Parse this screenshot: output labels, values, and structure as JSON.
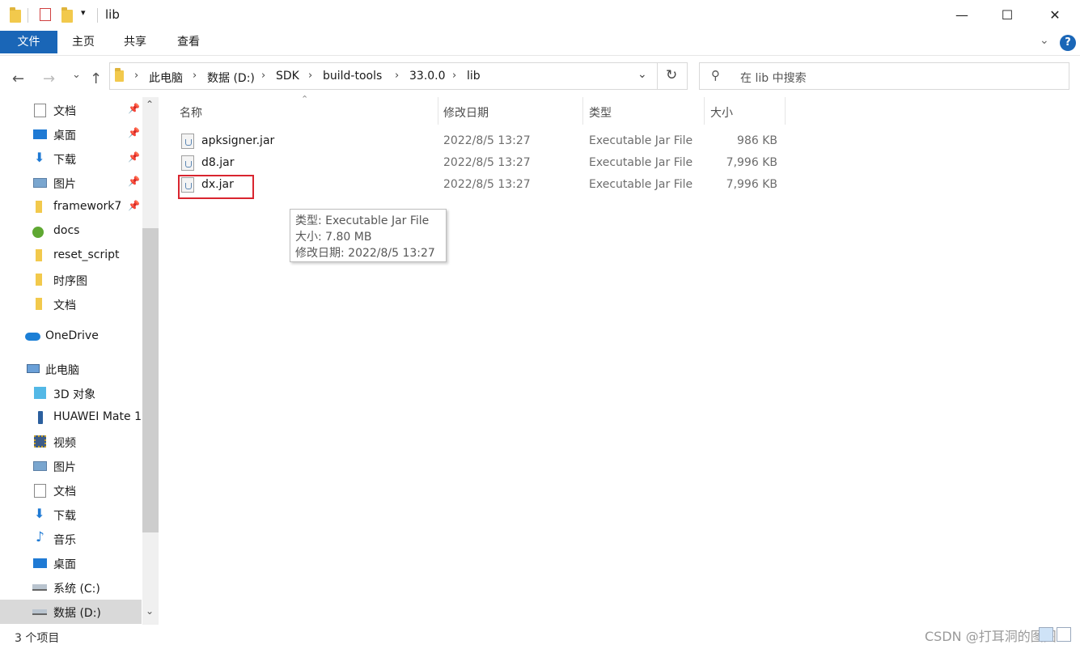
{
  "window": {
    "title": "lib",
    "controls": {
      "minimize": "—",
      "maximize": "☐",
      "close": "✕"
    }
  },
  "ribbon": {
    "tabs": [
      "文件",
      "主页",
      "共享",
      "查看"
    ],
    "expand_icon": "chevron-down-icon",
    "help": "?"
  },
  "navigation": {
    "back": "←",
    "forward": "→",
    "recent": "⌄",
    "up": "↑",
    "refresh": "↻",
    "breadcrumb": [
      "此电脑",
      "数据 (D:)",
      "SDK",
      "build-tools",
      "33.0.0",
      "lib"
    ],
    "dropdown": "⌄"
  },
  "search": {
    "placeholder": "在 lib 中搜索"
  },
  "sidebar": {
    "quick_access": [
      {
        "label": "文档",
        "icon": "document-icon",
        "pinned": true
      },
      {
        "label": "桌面",
        "icon": "desktop-icon",
        "pinned": true
      },
      {
        "label": "下载",
        "icon": "download-icon",
        "pinned": true
      },
      {
        "label": "图片",
        "icon": "pictures-icon",
        "pinned": true
      },
      {
        "label": "framework7",
        "icon": "folder-icon",
        "pinned": true
      },
      {
        "label": "docs",
        "icon": "folder-synced-icon",
        "pinned": false
      },
      {
        "label": "reset_script",
        "icon": "folder-icon",
        "pinned": false
      },
      {
        "label": "时序图",
        "icon": "folder-icon",
        "pinned": false
      },
      {
        "label": "文档",
        "icon": "folder-icon",
        "pinned": false
      }
    ],
    "onedrive": "OneDrive",
    "this_pc": "此电脑",
    "pc_items": [
      {
        "label": "3D 对象",
        "icon": "3d-objects-icon"
      },
      {
        "label": "HUAWEI Mate 1",
        "icon": "phone-icon"
      },
      {
        "label": "视频",
        "icon": "video-icon"
      },
      {
        "label": "图片",
        "icon": "pictures-icon"
      },
      {
        "label": "文档",
        "icon": "document-icon"
      },
      {
        "label": "下载",
        "icon": "download-icon"
      },
      {
        "label": "音乐",
        "icon": "music-icon"
      },
      {
        "label": "桌面",
        "icon": "desktop-icon"
      },
      {
        "label": "系统 (C:)",
        "icon": "drive-c-icon"
      },
      {
        "label": "数据 (D:)",
        "icon": "drive-icon",
        "selected": true
      }
    ],
    "scroll_up": "⌃",
    "scroll_down": "⌄"
  },
  "columns": {
    "name": "名称",
    "modified": "修改日期",
    "type": "类型",
    "size": "大小"
  },
  "files": [
    {
      "name": "apksigner.jar",
      "modified": "2022/8/5 13:27",
      "type": "Executable Jar File",
      "size": "986 KB"
    },
    {
      "name": "d8.jar",
      "modified": "2022/8/5 13:27",
      "type": "Executable Jar File",
      "size": "7,996 KB"
    },
    {
      "name": "dx.jar",
      "modified": "2022/8/5 13:27",
      "type": "Executable Jar File",
      "size": "7,996 KB"
    }
  ],
  "tooltip": {
    "type_line": "类型: Executable Jar File",
    "size_line": "大小: 7.80 MB",
    "date_line": "修改日期: 2022/8/5 13:27"
  },
  "status": {
    "item_count": "3 个项目"
  },
  "watermark": "CSDN @打耳洞的图图",
  "colors": {
    "accent": "#1a66b7",
    "highlight_box": "#d9252f",
    "selected_row": "#cce8ff"
  }
}
